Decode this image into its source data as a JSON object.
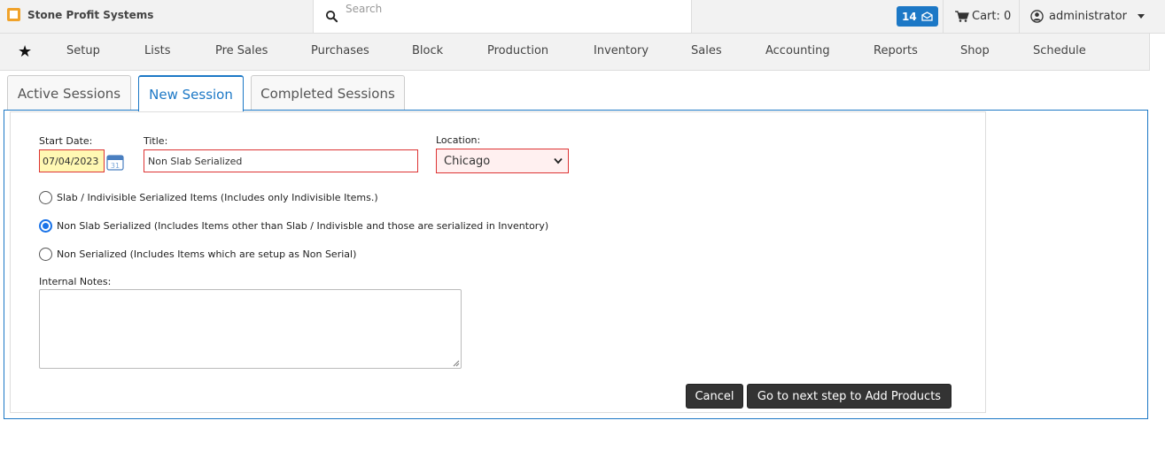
{
  "brand": {
    "name": "Stone Profit Systems",
    "logo_color": "#f0a22a"
  },
  "search": {
    "placeholder": "Search",
    "icon": "search-icon"
  },
  "header": {
    "notifications": "14",
    "cart_label": "Cart: 0",
    "user": "administrator"
  },
  "nav": {
    "items": [
      "Setup",
      "Lists",
      "Pre Sales",
      "Purchases",
      "Block",
      "Production",
      "Inventory",
      "Sales",
      "Accounting",
      "Reports",
      "Shop",
      "Schedule"
    ]
  },
  "tabs": [
    {
      "label": "Active Sessions",
      "active": false
    },
    {
      "label": "New Session",
      "active": true
    },
    {
      "label": "Completed Sessions",
      "active": false
    }
  ],
  "form": {
    "start_date_label": "Start Date:",
    "start_date_value": "07/04/2023",
    "title_label": "Title:",
    "title_value": "Non Slab Serialized",
    "location_label": "Location:",
    "location_value": "Chicago",
    "options": [
      {
        "label": "Slab / Indivisible Serialized Items (Includes only Indivisible Items.)",
        "checked": false
      },
      {
        "label": "Non Slab Serialized (Includes Items other than Slab / Indivisble and those are serialized in Inventory)",
        "checked": true
      },
      {
        "label": "Non Serialized (Includes Items which are setup as Non Serial)",
        "checked": false
      }
    ],
    "notes_label": "Internal Notes:",
    "notes_value": ""
  },
  "actions": {
    "cancel_label": "Cancel",
    "next_label": "Go to next step to Add Products"
  },
  "colors": {
    "accent": "#1c78c6",
    "error_border": "#d33",
    "date_highlight": "#fff8b3"
  }
}
